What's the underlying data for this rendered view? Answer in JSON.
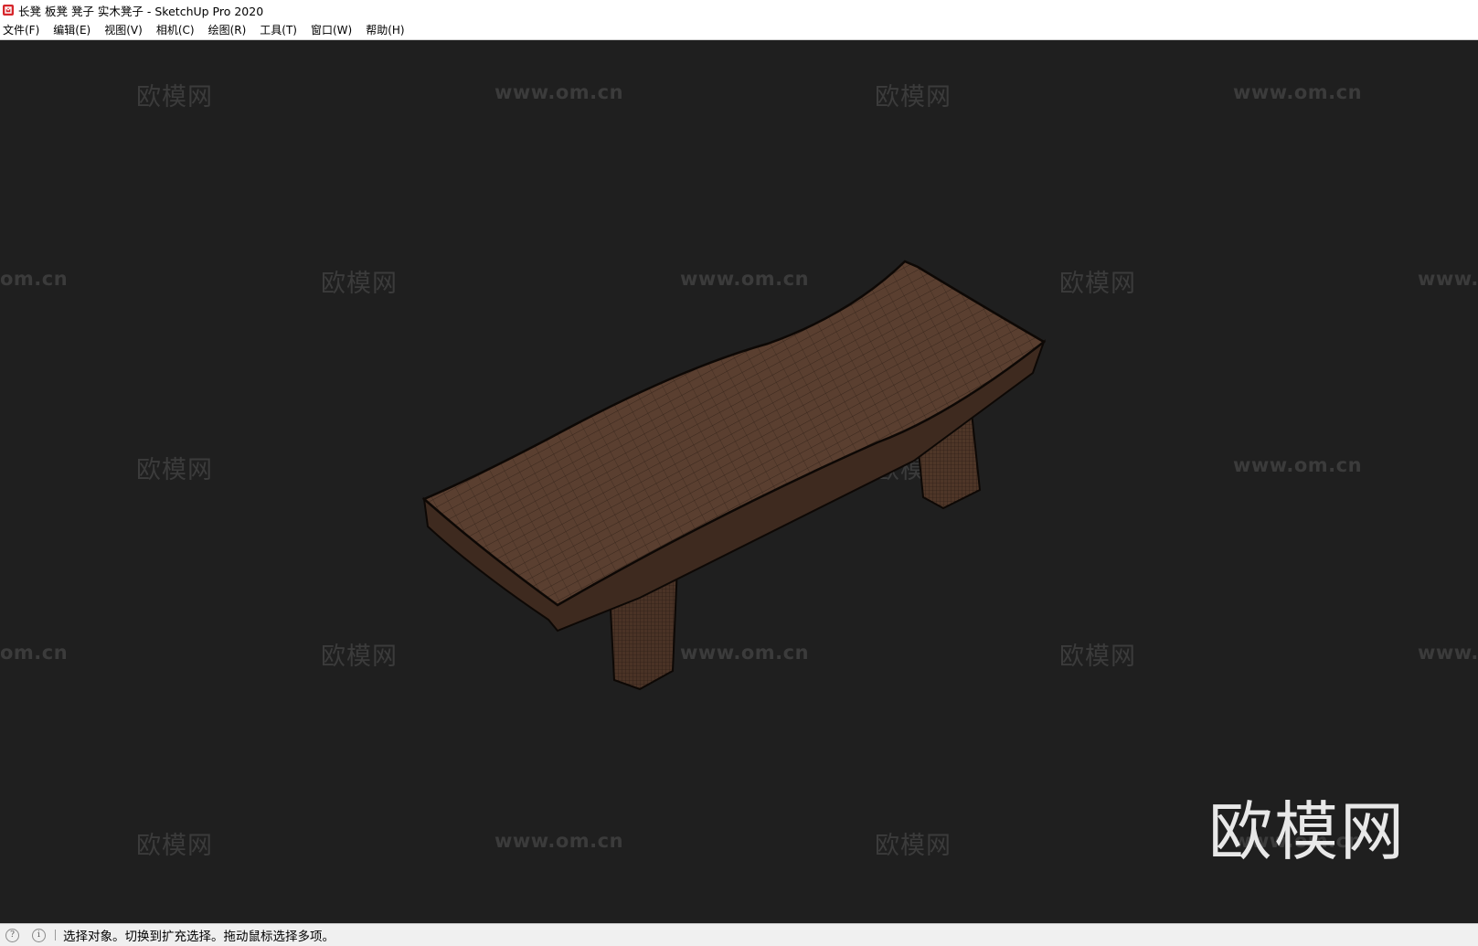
{
  "window": {
    "title": "长凳 板凳 凳子 实木凳子 - SketchUp Pro 2020"
  },
  "menu": {
    "items": [
      {
        "label": "文件(F)"
      },
      {
        "label": "编辑(E)"
      },
      {
        "label": "视图(V)"
      },
      {
        "label": "相机(C)"
      },
      {
        "label": "绘图(R)"
      },
      {
        "label": "工具(T)"
      },
      {
        "label": "窗口(W)"
      },
      {
        "label": "帮助(H)"
      }
    ]
  },
  "watermarks": {
    "logo": "欧模网",
    "url": "www.om.cn",
    "url_partial": "om.cn",
    "url_partial_right": "www."
  },
  "status": {
    "text": "选择对象。切换到扩充选择。拖动鼠标选择多项。",
    "icons": [
      "geo-location-icon",
      "info-icon"
    ]
  },
  "colors": {
    "viewport_bg": "#1f1f1f",
    "wood": "#5a3f30"
  }
}
